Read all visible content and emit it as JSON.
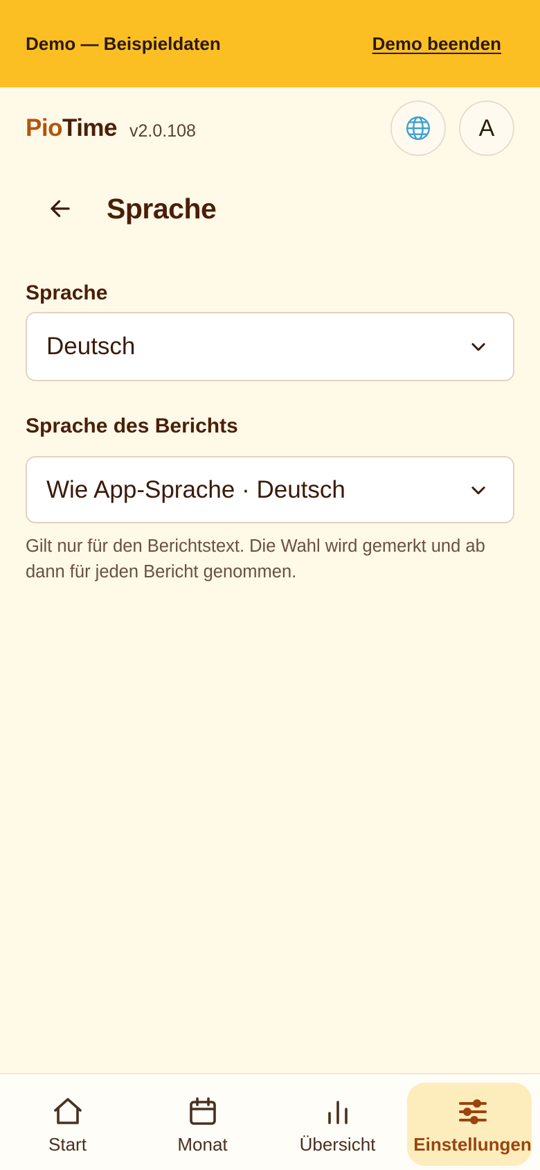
{
  "demo_banner": {
    "text": "Demo — Beispieldaten",
    "end_label": "Demo beenden"
  },
  "header": {
    "brand_pio": "Pio",
    "brand_time": "Time",
    "version": "v2.0.108",
    "language_icon": "globe-icon",
    "avatar_letter": "A"
  },
  "page": {
    "back_icon": "arrow-left-icon",
    "title": "Sprache"
  },
  "form": {
    "language": {
      "label": "Sprache",
      "value": "Deutsch"
    },
    "report_language": {
      "label": "Sprache des Berichts",
      "value": "Wie App-Sprache · Deutsch",
      "help": "Gilt nur für den Berichtstext. Die Wahl wird gemerkt und ab dann für jeden Bericht genommen."
    }
  },
  "bottom_nav": {
    "items": [
      {
        "label": "Start",
        "icon": "home-icon",
        "active": false
      },
      {
        "label": "Monat",
        "icon": "calendar-icon",
        "active": false
      },
      {
        "label": "Übersicht",
        "icon": "bar-chart-icon",
        "active": false
      },
      {
        "label": "Einstellungen",
        "icon": "sliders-icon",
        "active": true
      }
    ]
  },
  "colors": {
    "banner": "#fbbf24",
    "background": "#fff9e8",
    "brand_accent": "#b4540c",
    "text_primary": "#4a1f08",
    "active_nav_bg": "#fdedbd",
    "active_nav_text": "#9a4410"
  }
}
